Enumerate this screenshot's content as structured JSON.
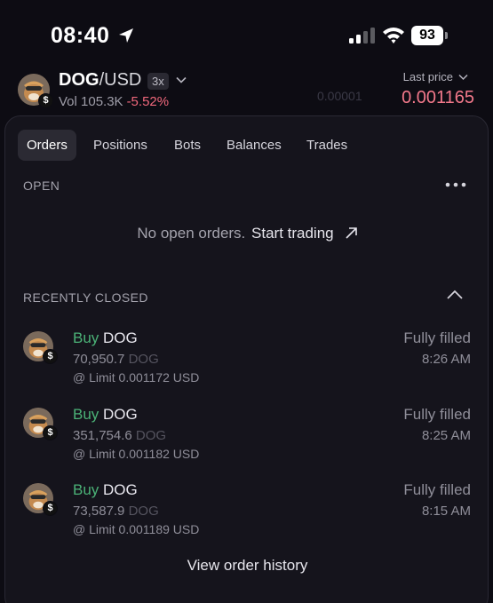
{
  "status_bar": {
    "time": "08:40",
    "battery": "93",
    "icons": [
      "location-arrow-icon",
      "cell-signal-icon",
      "wifi-icon",
      "battery-icon"
    ]
  },
  "ticker": {
    "base": "DOG",
    "separator": "/",
    "quote": "USD",
    "leverage": "3x",
    "volume": "Vol 105.3K",
    "change": "-5.52%",
    "last_price_label": "Last price",
    "last_price": "0.001165",
    "background_ghost_text": [
      "0.00001"
    ]
  },
  "tabs": [
    {
      "label": "Orders",
      "active": true
    },
    {
      "label": "Positions",
      "active": false
    },
    {
      "label": "Bots",
      "active": false
    },
    {
      "label": "Balances",
      "active": false
    },
    {
      "label": "Trades",
      "active": false
    }
  ],
  "open_section": {
    "title": "OPEN",
    "empty_text": "No open orders.",
    "cta": "Start trading"
  },
  "closed_section": {
    "title": "RECENTLY CLOSED",
    "orders": [
      {
        "side": "Buy",
        "asset": "DOG",
        "amount": "70,950.7",
        "unit": "DOG",
        "price": "@ Limit 0.001172 USD",
        "status": "Fully filled",
        "time": "8:26 AM"
      },
      {
        "side": "Buy",
        "asset": "DOG",
        "amount": "351,754.6",
        "unit": "DOG",
        "price": "@ Limit 0.001182 USD",
        "status": "Fully filled",
        "time": "8:25 AM"
      },
      {
        "side": "Buy",
        "asset": "DOG",
        "amount": "73,587.9",
        "unit": "DOG",
        "price": "@ Limit 0.001189 USD",
        "status": "Fully filled",
        "time": "8:15 AM"
      }
    ]
  },
  "footer": {
    "history_link": "View order history"
  },
  "colors": {
    "background": "#0d0c13",
    "panel": "#15141c",
    "positive": "#4bb277",
    "negative": "#f0687c",
    "price": "#f3798b"
  }
}
